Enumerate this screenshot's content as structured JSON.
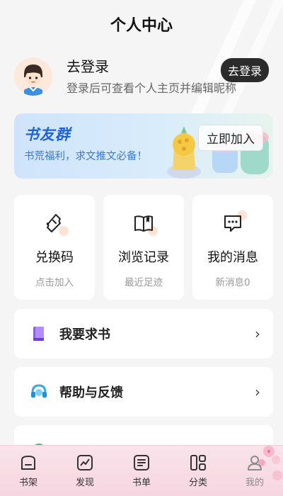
{
  "header": {
    "title": "个人中心"
  },
  "user": {
    "name": "去登录",
    "subtitle": "登录后可查看个人主页并编辑昵称",
    "login_button": "去登录"
  },
  "banner": {
    "title": "书友群",
    "subtitle": "书荒福利，求文推文必备！",
    "join_button": "立即加入"
  },
  "quick": [
    {
      "label": "兑换码",
      "sub": "点击加入",
      "icon": "ticket-icon"
    },
    {
      "label": "浏览记录",
      "sub": "最近足迹",
      "icon": "book-open-icon"
    },
    {
      "label": "我的消息",
      "sub": "新消息0",
      "icon": "message-icon"
    }
  ],
  "list": [
    {
      "label": "我要求书",
      "icon": "purple-book-icon"
    },
    {
      "label": "帮助与反馈",
      "icon": "headset-icon"
    },
    {
      "label": "",
      "icon": "settings-icon"
    }
  ],
  "nav": [
    {
      "label": "书架",
      "icon": "bookshelf-icon"
    },
    {
      "label": "发现",
      "icon": "chart-icon"
    },
    {
      "label": "书单",
      "icon": "list-icon"
    },
    {
      "label": "分类",
      "icon": "grid-icon"
    },
    {
      "label": "我的",
      "icon": "user-icon",
      "active": true
    }
  ]
}
